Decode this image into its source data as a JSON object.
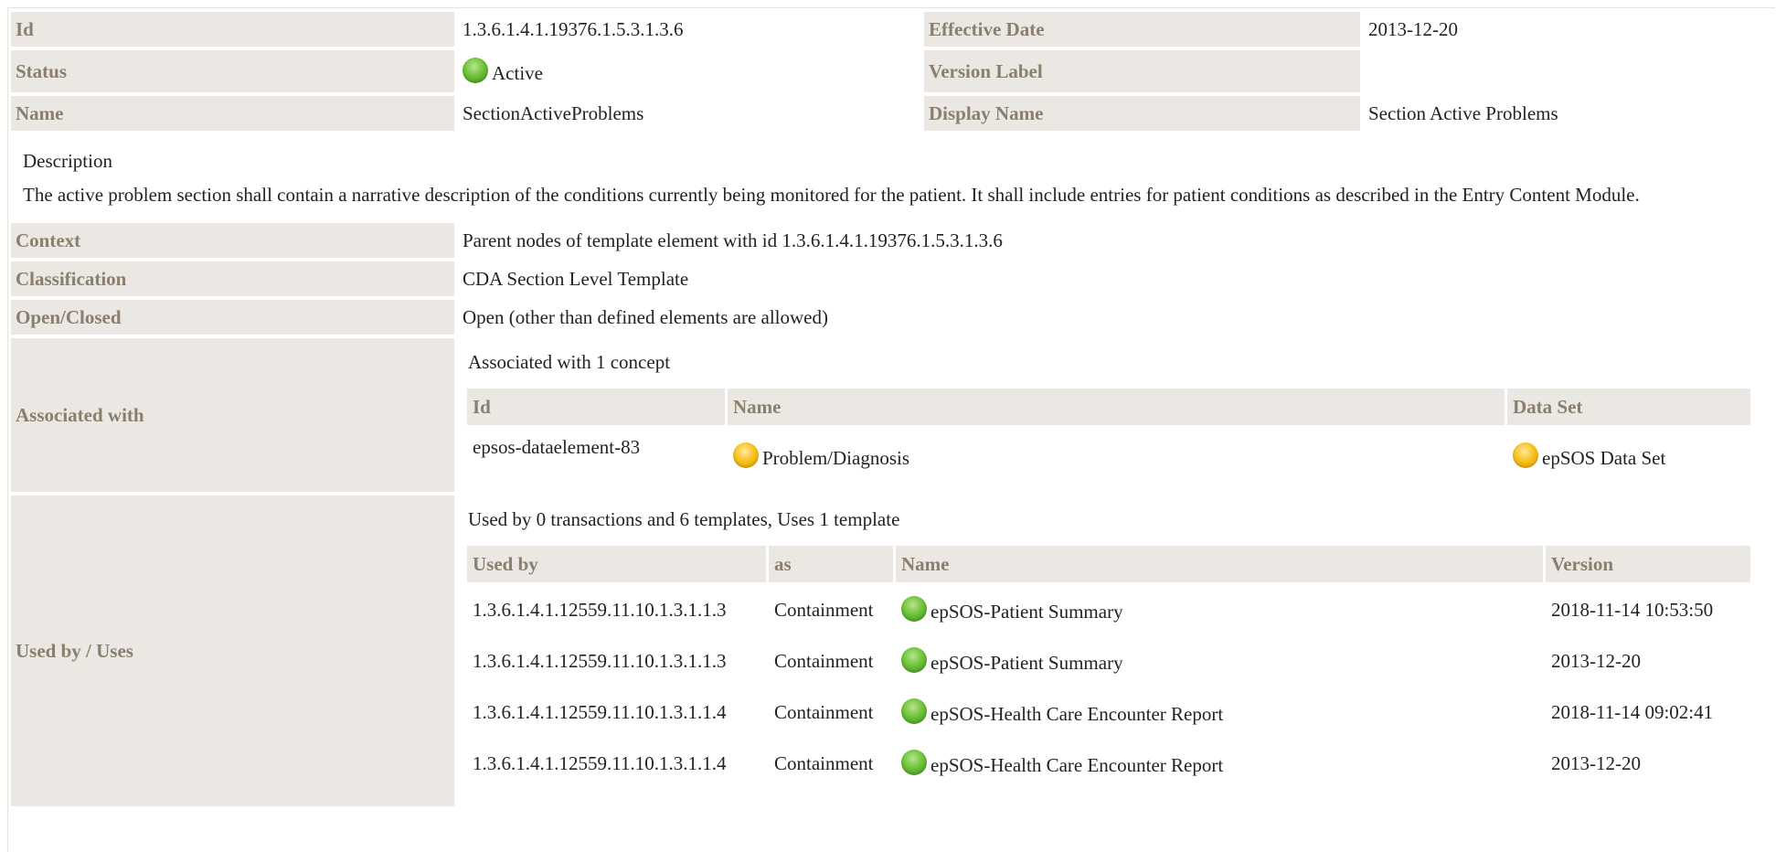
{
  "header": {
    "id_label": "Id",
    "id_value": "1.3.6.1.4.1.19376.1.5.3.1.3.6",
    "effective_label": "Effective Date",
    "effective_value": "2013-12-20",
    "status_label": "Status",
    "status_value": "Active",
    "status_color": "#6ec23a",
    "version_label": "Version Label",
    "version_value": "",
    "name_label": "Name",
    "name_value": "SectionActiveProblems",
    "display_label": "Display Name",
    "display_value": "Section Active Problems"
  },
  "description": {
    "title": "Description",
    "text": "The active problem section shall contain a narrative description of the conditions currently being monitored for the patient. It shall include entries for patient conditions as described in the Entry Content Module."
  },
  "details": {
    "context_label": "Context",
    "context_value": "Parent nodes of template element with id 1.3.6.1.4.1.19376.1.5.3.1.3.6",
    "classification_label": "Classification",
    "classification_value": "CDA Section Level Template",
    "open_label": "Open/Closed",
    "open_value": "Open (other than defined elements are allowed)"
  },
  "associated": {
    "label": "Associated with",
    "intro": "Associated with 1 concept",
    "headers": {
      "id": "Id",
      "name": "Name",
      "dataset": "Data Set"
    },
    "rows": [
      {
        "id": "epsos-dataelement-83",
        "name": "Problem/Diagnosis",
        "name_status": "yellow",
        "dataset": "epSOS Data Set",
        "dataset_status": "yellow"
      }
    ]
  },
  "usedby": {
    "label": "Used by / Uses",
    "intro": "Used by 0 transactions and 6 templates, Uses 1 template",
    "headers": {
      "used_by": "Used by",
      "as": "as",
      "name": "Name",
      "version": "Version"
    },
    "rows": [
      {
        "id": "1.3.6.1.4.1.12559.11.10.1.3.1.1.3",
        "as": "Containment",
        "name": "epSOS-Patient Summary",
        "status": "green",
        "version": "2018-11-14 10:53:50"
      },
      {
        "id": "1.3.6.1.4.1.12559.11.10.1.3.1.1.3",
        "as": "Containment",
        "name": "epSOS-Patient Summary",
        "status": "green",
        "version": "2013-12-20"
      },
      {
        "id": "1.3.6.1.4.1.12559.11.10.1.3.1.1.4",
        "as": "Containment",
        "name": "epSOS-Health Care Encounter Report",
        "status": "green",
        "version": "2018-11-14 09:02:41"
      },
      {
        "id": "1.3.6.1.4.1.12559.11.10.1.3.1.1.4",
        "as": "Containment",
        "name": "epSOS-Health Care Encounter Report",
        "status": "green",
        "version": "2013-12-20"
      }
    ]
  }
}
